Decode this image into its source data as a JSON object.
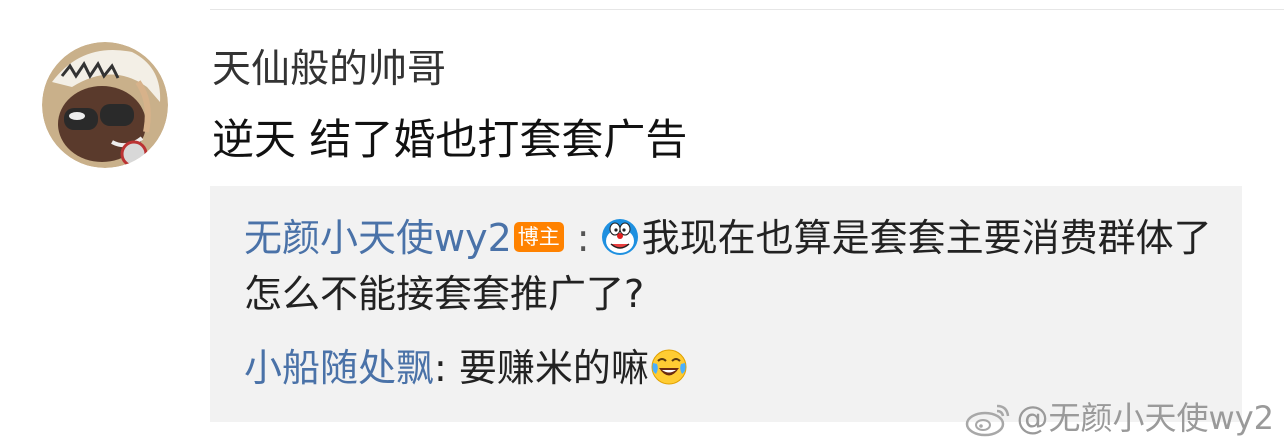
{
  "comment": {
    "username": "天仙般的帅哥",
    "text": "逆天 结了婚也打套套广告",
    "avatar_icon": "cartoon-avatar"
  },
  "replies": [
    {
      "name": "无颜小天使wy2",
      "badge": "博主",
      "separator": ":",
      "icon": "doraemon-emoji",
      "text": "我现在也算是套套主要消费群体了怎么不能接套套推广了?"
    },
    {
      "name": "小船随处飘",
      "separator": ":",
      "text": " 要赚米的嘛",
      "icon": "laugh-cry-emoji"
    }
  ],
  "watermark": {
    "text": "@无颜小天使wy2",
    "icon": "weibo-logo"
  },
  "colors": {
    "link": "#4a72a8",
    "badge": "#ff8200",
    "reply_bg": "#f2f2f2"
  }
}
